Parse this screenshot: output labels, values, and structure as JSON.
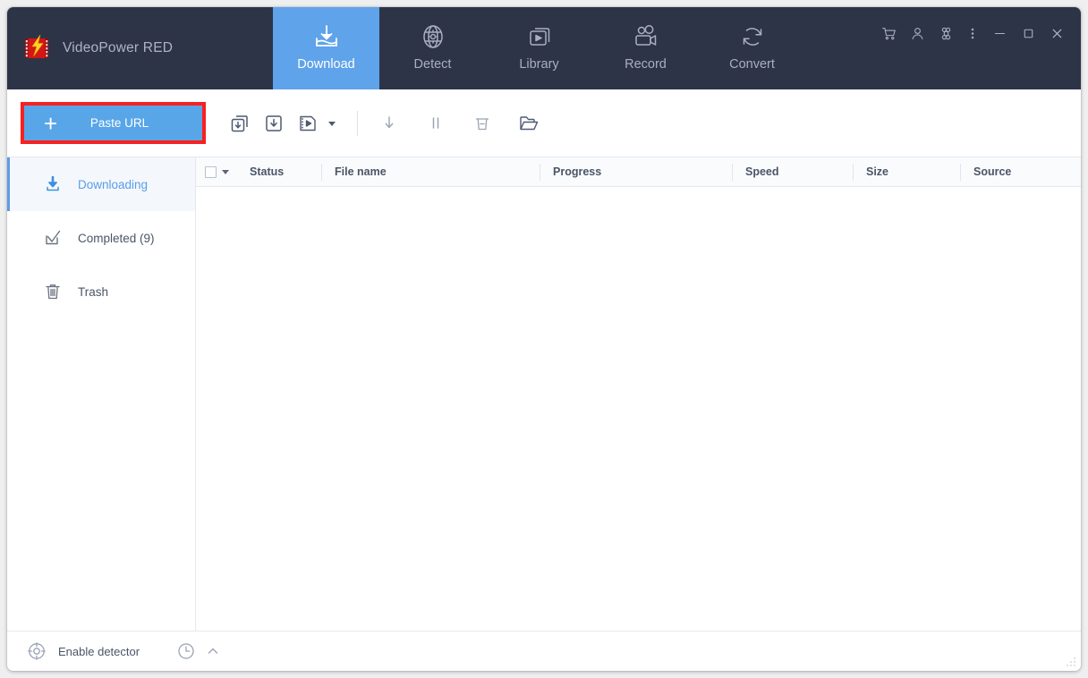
{
  "app": {
    "title": "VideoPower RED",
    "logo_icon": "videopower-logo-icon",
    "accent_blue": "#5fa3ea",
    "header_bg": "#2e3447",
    "highlight_red": "#f82020"
  },
  "header": {
    "tabs": [
      {
        "label": "Download",
        "icon": "download-tray-icon",
        "active": true
      },
      {
        "label": "Detect",
        "icon": "detect-radar-icon",
        "active": false
      },
      {
        "label": "Library",
        "icon": "library-play-icon",
        "active": false
      },
      {
        "label": "Record",
        "icon": "record-camera-icon",
        "active": false
      },
      {
        "label": "Convert",
        "icon": "convert-refresh-icon",
        "active": false
      }
    ],
    "window_buttons": [
      {
        "name": "cart-icon",
        "title": "Store"
      },
      {
        "name": "user-icon",
        "title": "Account"
      },
      {
        "name": "apps-icon",
        "title": "Apps"
      },
      {
        "name": "more-menu-icon",
        "title": "Menu"
      },
      {
        "name": "minimize-icon",
        "title": "Minimize"
      },
      {
        "name": "maximize-icon",
        "title": "Maximize"
      },
      {
        "name": "close-icon",
        "title": "Close"
      }
    ]
  },
  "toolbar": {
    "paste_url_label": "Paste URL",
    "paste_url_plus": "+",
    "buttons": [
      {
        "name": "batch-download-icon",
        "title": "Batch download"
      },
      {
        "name": "single-download-icon",
        "title": "Download"
      },
      {
        "name": "video-download-icon",
        "title": "Download video"
      },
      {
        "name": "video-download-caret-icon",
        "title": "More download options"
      },
      {
        "name": "start-download-icon",
        "title": "Start"
      },
      {
        "name": "pause-download-icon",
        "title": "Pause"
      },
      {
        "name": "delete-icon",
        "title": "Delete"
      },
      {
        "name": "open-folder-icon",
        "title": "Open folder"
      }
    ]
  },
  "sidebar": {
    "items": [
      {
        "label": "Downloading",
        "icon": "downloading-icon",
        "active": true
      },
      {
        "label": "Completed (9)",
        "icon": "completed-check-icon",
        "active": false
      },
      {
        "label": "Trash",
        "icon": "trash-icon",
        "active": false
      }
    ]
  },
  "table": {
    "columns": [
      {
        "key": "status",
        "label": "Status"
      },
      {
        "key": "filename",
        "label": "File name"
      },
      {
        "key": "progress",
        "label": "Progress"
      },
      {
        "key": "speed",
        "label": "Speed"
      },
      {
        "key": "size",
        "label": "Size"
      },
      {
        "key": "source",
        "label": "Source"
      }
    ],
    "rows": []
  },
  "statusbar": {
    "detector_label": "Enable detector",
    "detector_icon": "detector-target-icon",
    "schedule_icon": "clock-icon",
    "expand_icon": "chevron-up-icon"
  }
}
